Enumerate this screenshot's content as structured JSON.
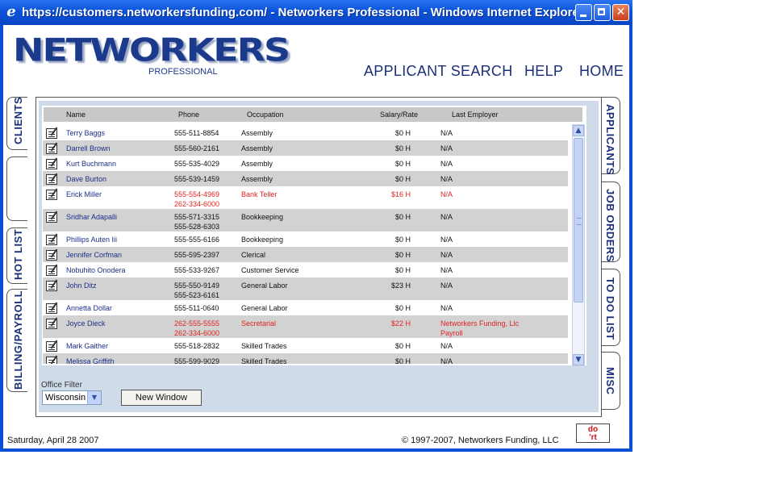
{
  "window": {
    "title": "https://customers.networkersfunding.com/ - Networkers Professional - Windows Internet Explorer"
  },
  "logo": {
    "main": "NETWORKERS",
    "sub": "PROFESSIONAL"
  },
  "nav": {
    "applicant_search": "APPLICANT SEARCH",
    "help": "HELP",
    "home": "HOME"
  },
  "left_tabs": {
    "clients": "CLIENTS",
    "blank": "",
    "hot_list": "HOT LIST",
    "billing": "BILLING/PAYROLL"
  },
  "right_tabs": {
    "applicants": "APPLICANTS",
    "job_orders": "JOB ORDERS",
    "todo": "TO DO LIST",
    "misc": "MISC"
  },
  "table": {
    "headers": {
      "name": "Name",
      "phone": "Phone",
      "occupation": "Occupation",
      "salary": "Salary/Rate",
      "employer": "Last Employer"
    },
    "rows": [
      {
        "name": "Terry Baggs",
        "phone": "555-511-8854",
        "phone2": "",
        "occupation": "Assembly",
        "salary": "$0 H",
        "employer": "N/A",
        "employer2": ""
      },
      {
        "name": "Darrell Brown",
        "phone": "555-560-2161",
        "phone2": "",
        "occupation": "Assembly",
        "salary": "$0 H",
        "employer": "N/A",
        "employer2": ""
      },
      {
        "name": "Kurt Buchmann",
        "phone": "555-535-4029",
        "phone2": "",
        "occupation": "Assembly",
        "salary": "$0 H",
        "employer": "N/A",
        "employer2": ""
      },
      {
        "name": "Dave Burton",
        "phone": "555-539-1459",
        "phone2": "",
        "occupation": "Assembly",
        "salary": "$0 H",
        "employer": "N/A",
        "employer2": ""
      },
      {
        "name": "Erick Miller",
        "phone": "555-554-4969",
        "phone2": "262-334-6000",
        "occupation": "Bank Teller",
        "salary": "$16 H",
        "employer": "N/A",
        "employer2": ""
      },
      {
        "name": "Sridhar Adapalli",
        "phone": "555-571-3315",
        "phone2": "555-528-6303",
        "occupation": "Bookkeeping",
        "salary": "$0 H",
        "employer": "N/A",
        "employer2": ""
      },
      {
        "name": "Phillips Auten Iii",
        "phone": "555-555-6166",
        "phone2": "",
        "occupation": "Bookkeeping",
        "salary": "$0 H",
        "employer": "N/A",
        "employer2": ""
      },
      {
        "name": "Jennifer Corfman",
        "phone": "555-595-2397",
        "phone2": "",
        "occupation": "Clerical",
        "salary": "$0 H",
        "employer": "N/A",
        "employer2": ""
      },
      {
        "name": "Nobuhito Onodera",
        "phone": "555-533-9267",
        "phone2": "",
        "occupation": "Customer Service",
        "salary": "$0 H",
        "employer": "N/A",
        "employer2": ""
      },
      {
        "name": "John Ditz",
        "phone": "555-550-9149",
        "phone2": "555-523-6161",
        "occupation": "General Labor",
        "salary": "$23 H",
        "employer": "N/A",
        "employer2": ""
      },
      {
        "name": "Annetta Dollar",
        "phone": "555-511-0640",
        "phone2": "",
        "occupation": "General Labor",
        "salary": "$0 H",
        "employer": "N/A",
        "employer2": ""
      },
      {
        "name": "Joyce Dieck",
        "phone": "262-555-5555",
        "phone2": "262-334-6000",
        "occupation": "Secretarial",
        "salary": "$22 H",
        "employer": "Networkers Funding, Llc",
        "employer2": "Payroll"
      },
      {
        "name": "Mark Gaither",
        "phone": "555-518-2832",
        "phone2": "",
        "occupation": "Skilled Trades",
        "salary": "$0 H",
        "employer": "N/A",
        "employer2": ""
      },
      {
        "name": "Melissa Griffith",
        "phone": "555-599-9029",
        "phone2": "",
        "occupation": "Skilled Trades",
        "salary": "$0 H",
        "employer": "N/A",
        "employer2": ""
      }
    ]
  },
  "filter": {
    "label": "Office Filter",
    "value": "Wisconsin"
  },
  "buttons": {
    "new_window": "New Window",
    "doit": "do\n'rt"
  },
  "footer": {
    "date": "Saturday, April 28 2007",
    "copyright": "© 1997-2007, Networkers Funding, LLC"
  }
}
